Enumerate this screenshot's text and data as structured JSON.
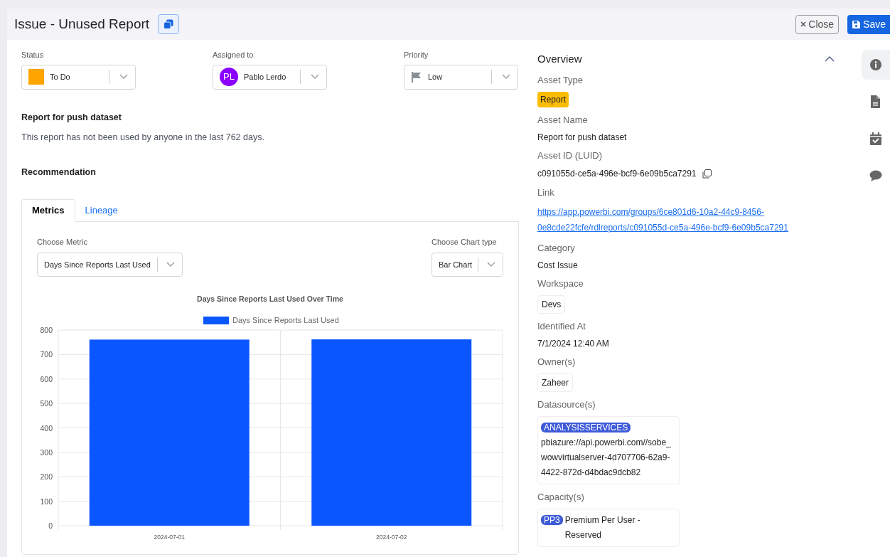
{
  "header": {
    "title": "Issue - Unused Report",
    "buttons": [
      {
        "label": "Close",
        "kind": "close"
      },
      {
        "label": "Save",
        "kind": "save"
      }
    ]
  },
  "fields": [
    {
      "label": "Status",
      "value": "To Do",
      "kind": "status",
      "color": "#ffa500"
    },
    {
      "label": "Assigned to",
      "value": "Pablo Lerdo",
      "kind": "avatar",
      "initials": "PL",
      "color": "#8b00ff"
    },
    {
      "label": "Priority",
      "value": "Low",
      "kind": "flag"
    }
  ],
  "description": {
    "title": "Report for push dataset",
    "text": "This report has not been used by anyone in the last 762 days."
  },
  "recommendation": {
    "title": "Recommendation"
  },
  "tabs": [
    {
      "label": "Metrics",
      "selected": true
    },
    {
      "label": "Lineage",
      "selected": false
    }
  ],
  "metric_select": {
    "label": "Choose Metric",
    "value": "Days Since Reports Last Used"
  },
  "chart_type_select": {
    "label": "Choose Chart type",
    "value": "Bar Chart"
  },
  "chart_data": {
    "type": "bar",
    "title": "Days Since Reports Last Used Over Time",
    "categories": [
      "2024-07-01",
      "2024-07-02"
    ],
    "series": [
      {
        "name": "Days Since Reports Last Used",
        "color": "#0b57ff",
        "values": [
          761,
          762
        ]
      }
    ],
    "grid": true,
    "ylim": [
      0,
      800
    ],
    "yticks": [
      0,
      100,
      200,
      300,
      400,
      500,
      600,
      700,
      800
    ]
  },
  "overview": {
    "title": "Overview",
    "expanded": true,
    "items": [
      {
        "label": "Asset Type",
        "value": "Report",
        "kind": "tag"
      },
      {
        "label": "Asset Name",
        "value": "Report for push dataset",
        "kind": "text"
      },
      {
        "label": "Asset ID (LUID)",
        "value": "c091055d-ce5a-496e-bcf9-6e09b5ca7291",
        "kind": "copy"
      },
      {
        "label": "Link",
        "value": "https://app.powerbi.com/groups/6ce801d6-10a2-44c9-8456-0e8cde22fcfe/rdlreports/c091055d-ce5a-496e-bcf9-6e09b5ca7291",
        "kind": "link"
      },
      {
        "label": "Category",
        "value": "Cost Issue",
        "kind": "text"
      },
      {
        "label": "Workspace",
        "value": "Devs",
        "kind": "chip"
      },
      {
        "label": "Identified At",
        "value": "7/1/2024 12:40 AM",
        "kind": "text"
      },
      {
        "label": "Owner(s)",
        "value": "Zaheer",
        "kind": "chip"
      },
      {
        "label": "Datasource(s)",
        "badge": "ANALYSISSERVICES",
        "value": "pbiazure://api.powerbi.com//sobe_wowvirtualserver-4d707706-62a9-4422-872d-d4bdac9dcb82",
        "kind": "badged"
      },
      {
        "label": "Capacity(s)",
        "badge": "PP3",
        "value": "Premium Per User - Reserved",
        "kind": "badged-inline"
      }
    ]
  },
  "rail": [
    {
      "kind": "info",
      "selected": true
    },
    {
      "kind": "document",
      "selected": false
    },
    {
      "kind": "calendar",
      "selected": false
    },
    {
      "kind": "comment",
      "selected": false
    }
  ]
}
